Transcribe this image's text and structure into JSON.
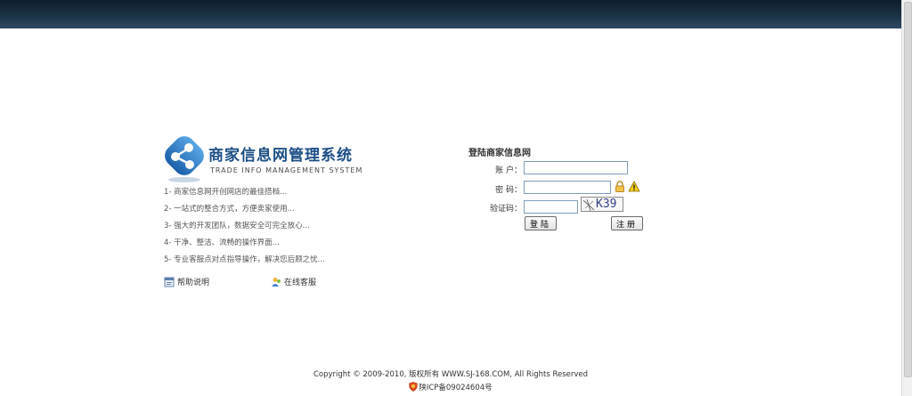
{
  "brand": {
    "title": "商家信息网管理系统",
    "subtitle": "TRADE INFO MANAGEMENT SYSTEM",
    "color": "#1c4f86"
  },
  "features": [
    "1- 商家信息网开创网店的最佳搭档...",
    "2- 一站式的整合方式，方便卖家使用...",
    "3- 强大的开发团队，数据安全可完全放心...",
    "4- 干净、整洁、流畅的操作界面...",
    "5- 专业客服点对点指导操作，解决您后顾之忧..."
  ],
  "help_links": {
    "help": "帮助说明",
    "online_service": "在线客服"
  },
  "login": {
    "title": "登陆商家信息网",
    "account_label": "账 户：",
    "password_label": "密 码：",
    "captcha_label": "验证码：",
    "account_value": "",
    "password_value": "",
    "captcha_value": "",
    "captcha_image_text": "K39",
    "login_button": "登陆",
    "register_button": "注册"
  },
  "footer": {
    "copyright": "Copyright © 2009-2010, 版权所有  WWW.SJ-168.COM, All Rights Reserved",
    "icp": "陕ICP备09024604号"
  },
  "colors": {
    "topbar": "#1c3246",
    "input_border": "#7f9db9"
  }
}
